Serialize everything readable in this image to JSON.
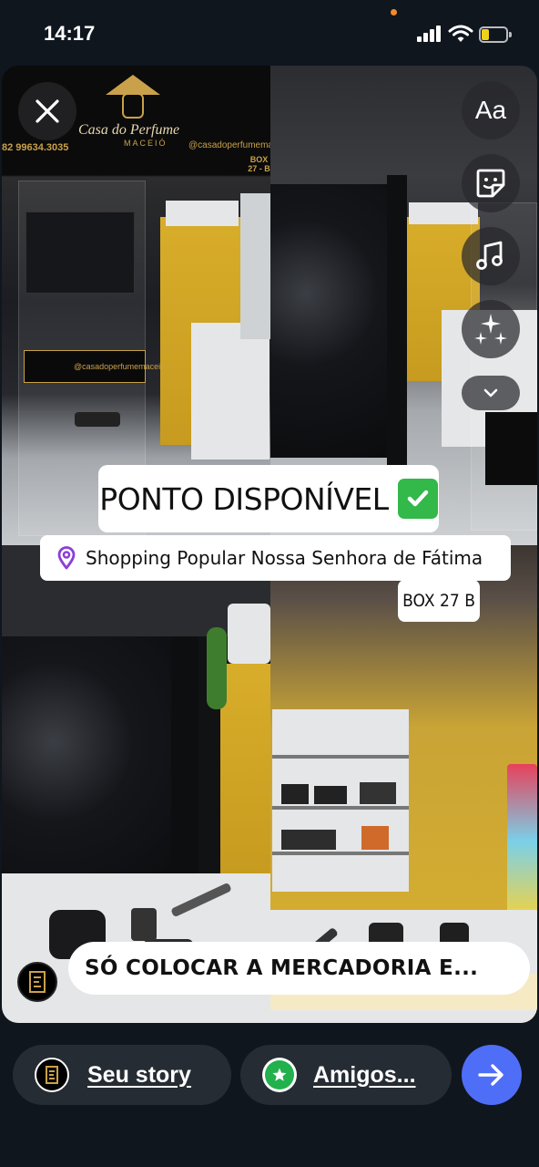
{
  "status_bar": {
    "time": "14:17",
    "signal_icon": "cellular-signal-icon",
    "wifi_icon": "wifi-icon",
    "battery_icon": "battery-low-icon",
    "battery_level": 0.2,
    "battery_color": "#f1d21b"
  },
  "photo": {
    "store_sign_name": "Casa do Perfume",
    "store_sign_city": "MACEIÓ",
    "store_sign_phone": "82 99634.3035",
    "store_sign_instagram": "@casadoperfumemaceio",
    "store_sign_box": "BOX 27 - B",
    "chair_sign_instagram": "@casadoperfumemaceio"
  },
  "stickers": {
    "headline": "PONTO DISPONÍVEL",
    "headline_emoji": "check-mark-button-icon",
    "location_icon": "location-pin-icon",
    "location": "Shopping Popular Nossa Senhora de Fátima",
    "box": "BOX 27 B",
    "caption": "SÓ COLOCAR A MERCADORIA E..."
  },
  "editor_tools": {
    "close_icon": "close-icon",
    "text_label": "Aa",
    "sticker_icon": "sticker-icon",
    "music_icon": "music-note-icon",
    "effects_icon": "sparkles-icon",
    "more_icon": "chevron-down-icon"
  },
  "bottom_bar": {
    "your_story_label": "Seu story",
    "close_friends_label": "Amigos...",
    "close_friends_color": "#22b14c",
    "send_icon": "arrow-right-icon",
    "send_color": "#4f6ef7"
  }
}
